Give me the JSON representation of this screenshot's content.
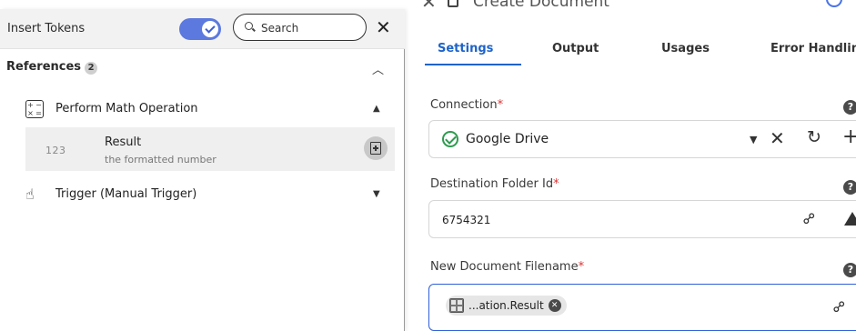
{
  "document": {
    "title": "Create Document",
    "tabs": [
      {
        "label": "Settings"
      },
      {
        "label": "Output"
      },
      {
        "label": "Usages"
      },
      {
        "label": "Error Handling"
      }
    ],
    "fields": {
      "connection": {
        "label": "Connection",
        "required_mark": "*",
        "value": "Google Drive"
      },
      "folder": {
        "label": "Destination Folder Id",
        "required_mark": "*",
        "value": "6754321"
      },
      "filename": {
        "label": "New Document Filename",
        "required_mark": "*",
        "chip_text": "...ation.Result"
      }
    },
    "help_glyph": "?"
  },
  "panel": {
    "title": "Insert Tokens",
    "search": {
      "placeholder": "Search"
    },
    "close_glyph": "✕",
    "references": {
      "label": "References",
      "count": "2"
    },
    "items": [
      {
        "label": "Perform Math Operation",
        "icon": "math-operation-icon",
        "expanded": true
      },
      {
        "label": "Trigger (Manual Trigger)",
        "icon": "pointer-hand-icon",
        "expanded": false
      }
    ],
    "result": {
      "type": "123",
      "name": "Result",
      "description": "the formatted number"
    }
  },
  "colors": {
    "accent": "#1e63c9",
    "toggle": "#5b79de",
    "success": "#2e9b4f"
  }
}
